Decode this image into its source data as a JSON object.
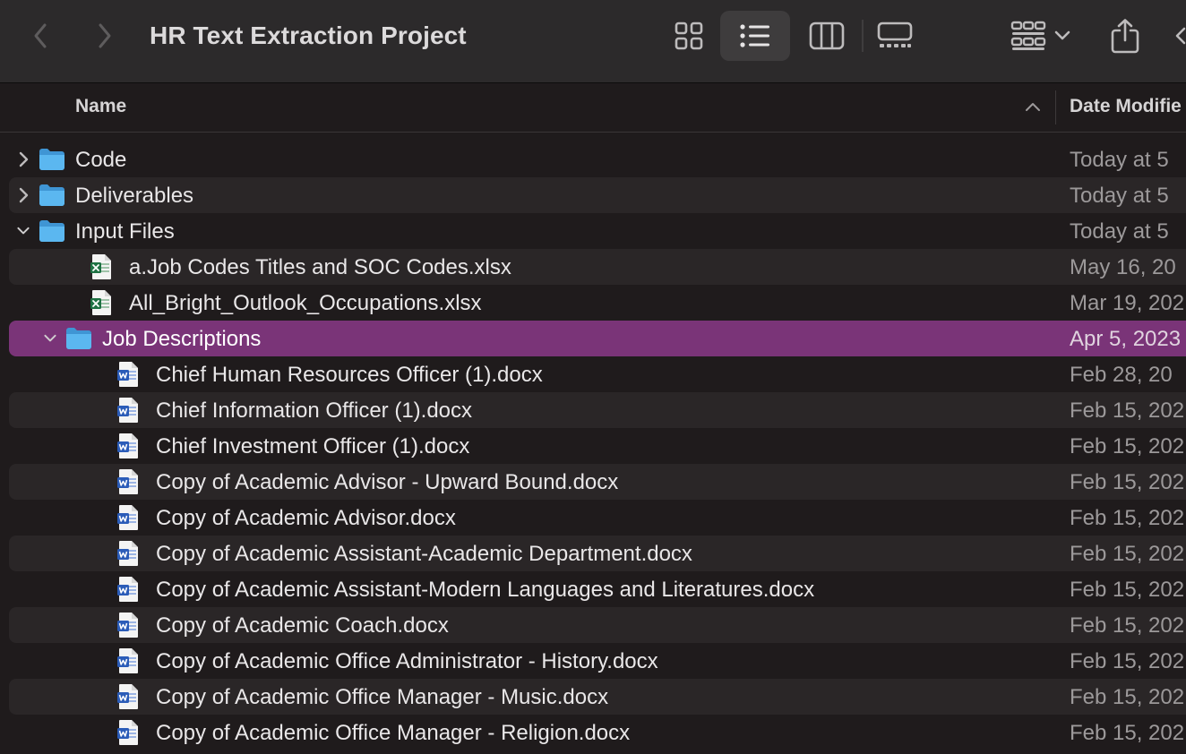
{
  "window": {
    "title": "HR Text Extraction Project"
  },
  "toolbar": {
    "back_icon": "chevron-left-icon",
    "forward_icon": "chevron-right-icon",
    "view_icons": [
      "icon-view-icon",
      "list-view-icon",
      "column-view-icon",
      "gallery-view-icon"
    ],
    "selected_view": "list-view-icon",
    "group_icon": "group-by-icon",
    "share_icon": "share-icon"
  },
  "columns": {
    "name": "Name",
    "date_modified": "Date Modifie"
  },
  "colors": {
    "selection": "#7a3478",
    "folder": "#59b4ee",
    "excel": "#1f7244",
    "word": "#2b5cb8"
  },
  "rows": [
    {
      "name": "Code",
      "date": "Today at 5",
      "kind": "folder",
      "depth": 0,
      "disclosure": "collapsed"
    },
    {
      "name": "Deliverables",
      "date": "Today at 5",
      "kind": "folder",
      "depth": 0,
      "disclosure": "collapsed"
    },
    {
      "name": "Input Files",
      "date": "Today at 5",
      "kind": "folder",
      "depth": 0,
      "disclosure": "expanded"
    },
    {
      "name": "a.Job Codes Titles and SOC Codes.xlsx",
      "date": "May 16, 20",
      "kind": "excel",
      "depth": 1,
      "disclosure": "none"
    },
    {
      "name": "All_Bright_Outlook_Occupations.xlsx",
      "date": "Mar 19, 202",
      "kind": "excel",
      "depth": 1,
      "disclosure": "none"
    },
    {
      "name": "Job Descriptions",
      "date": "Apr 5, 2023",
      "kind": "folder",
      "depth": 1,
      "disclosure": "expanded",
      "selected": true
    },
    {
      "name": "Chief Human Resources Officer (1).docx",
      "date": "Feb 28, 20",
      "kind": "word",
      "depth": 2,
      "disclosure": "none"
    },
    {
      "name": "Chief Information Officer (1).docx",
      "date": "Feb 15, 202",
      "kind": "word",
      "depth": 2,
      "disclosure": "none"
    },
    {
      "name": "Chief Investment Officer (1).docx",
      "date": "Feb 15, 202",
      "kind": "word",
      "depth": 2,
      "disclosure": "none"
    },
    {
      "name": "Copy of Academic Advisor - Upward Bound.docx",
      "date": "Feb 15, 202",
      "kind": "word",
      "depth": 2,
      "disclosure": "none"
    },
    {
      "name": "Copy of Academic Advisor.docx",
      "date": "Feb 15, 202",
      "kind": "word",
      "depth": 2,
      "disclosure": "none"
    },
    {
      "name": "Copy of Academic Assistant-Academic Department.docx",
      "date": "Feb 15, 202",
      "kind": "word",
      "depth": 2,
      "disclosure": "none"
    },
    {
      "name": "Copy of Academic Assistant-Modern Languages and Literatures.docx",
      "date": "Feb 15, 202",
      "kind": "word",
      "depth": 2,
      "disclosure": "none"
    },
    {
      "name": "Copy of Academic Coach.docx",
      "date": "Feb 15, 202",
      "kind": "word",
      "depth": 2,
      "disclosure": "none"
    },
    {
      "name": "Copy of Academic Office Administrator - History.docx",
      "date": "Feb 15, 202",
      "kind": "word",
      "depth": 2,
      "disclosure": "none"
    },
    {
      "name": "Copy of Academic Office Manager - Music.docx",
      "date": "Feb 15, 202",
      "kind": "word",
      "depth": 2,
      "disclosure": "none"
    },
    {
      "name": "Copy of Academic Office Manager - Religion.docx",
      "date": "Feb 15, 202",
      "kind": "word",
      "depth": 2,
      "disclosure": "none"
    }
  ]
}
